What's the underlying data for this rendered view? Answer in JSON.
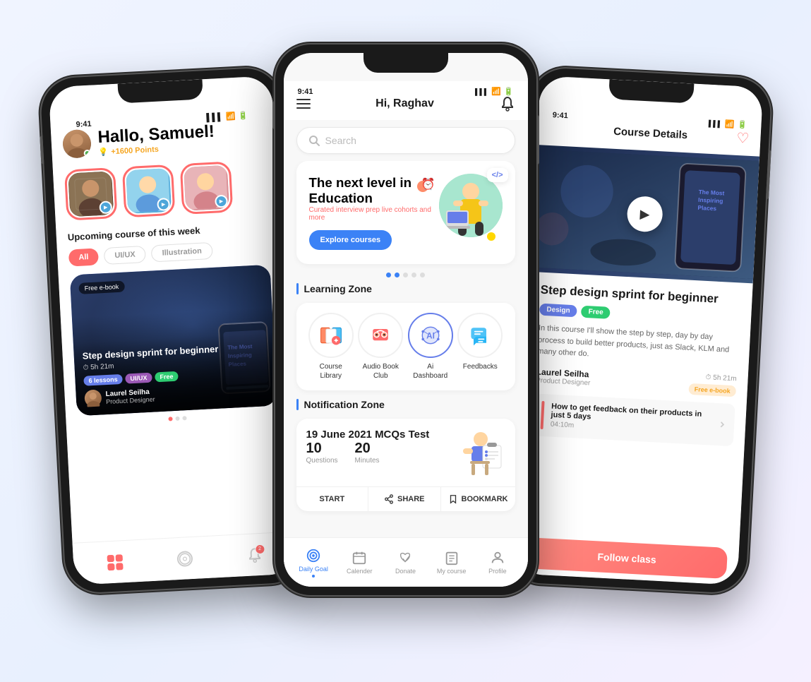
{
  "leftPhone": {
    "statusTime": "9:41",
    "greeting": "Hallo, Samuel!",
    "points": "+1600 Points",
    "stories": [
      {
        "id": 1,
        "hasVideo": true
      },
      {
        "id": 2,
        "hasVideo": true
      },
      {
        "id": 3,
        "hasVideo": true
      }
    ],
    "sectionTitle": "Upcoming",
    "sectionSubtitle": "course of this week",
    "filters": [
      "All",
      "UI/UX",
      "Illustration"
    ],
    "activeFilter": "All",
    "courseCard": {
      "badge": "Free e-book",
      "title": "Step design sprint for beginner",
      "duration": "5h 21m",
      "tags": [
        "6 lessons",
        "UI/UX",
        "Free"
      ],
      "instructor": "Laurel Seilha",
      "instructorRole": "Product Designer"
    },
    "nav": [
      "grid-icon",
      "compass-icon",
      "bell-icon"
    ]
  },
  "centerPhone": {
    "statusTime": "9:41",
    "greeting": "Hi, Raghav",
    "searchPlaceholder": "Search",
    "banner": {
      "title": "The next level in Education",
      "subtitle": "Curated interview prep live cohorts and more",
      "buttonLabel": "Explore courses"
    },
    "learningZone": {
      "sectionTitle": "Learning Zone",
      "items": [
        {
          "label": "Course\nLibrary",
          "emoji": "📚"
        },
        {
          "label": "Audio Book\nClub",
          "emoji": "🎧"
        },
        {
          "label": "Ai\nDashboard",
          "emoji": "🤖"
        },
        {
          "label": "Feedbacks",
          "emoji": "💬"
        }
      ]
    },
    "notificationZone": {
      "sectionTitle": "Notification Zone",
      "examTitle": "19 June 2021 MCQs Test",
      "questions": "10",
      "questionsLabel": "Questions",
      "minutes": "20",
      "minutesLabel": "Minutes",
      "actions": [
        "START",
        "SHARE",
        "BOOKMARK"
      ]
    },
    "nav": [
      {
        "label": "Daily Goal",
        "active": true
      },
      {
        "label": "Calender",
        "active": false
      },
      {
        "label": "Donate",
        "active": false
      },
      {
        "label": "My course",
        "active": false
      },
      {
        "label": "Profile",
        "active": false
      }
    ]
  },
  "rightPhone": {
    "statusTime": "9:41",
    "headerTitle": "Course Details",
    "courseTitle": "design sprint for\nnner",
    "courseTitleFull": "Step design sprint for beginner",
    "badges": [
      "Design",
      "Free"
    ],
    "description": "ourse I'll show the step by step, day by\ncess to build better products, just as\nSlack, KLM and manu other do.",
    "instructor": "Laurel Seilha",
    "instructorRole": "Product Designer",
    "duration": "5h 21m",
    "durationBadge": "Free e-book",
    "relatedLesson": {
      "title": "How to get feedback on their\nproducts in just 5 days",
      "duration": "04:10m"
    },
    "followButton": "Follow class"
  }
}
